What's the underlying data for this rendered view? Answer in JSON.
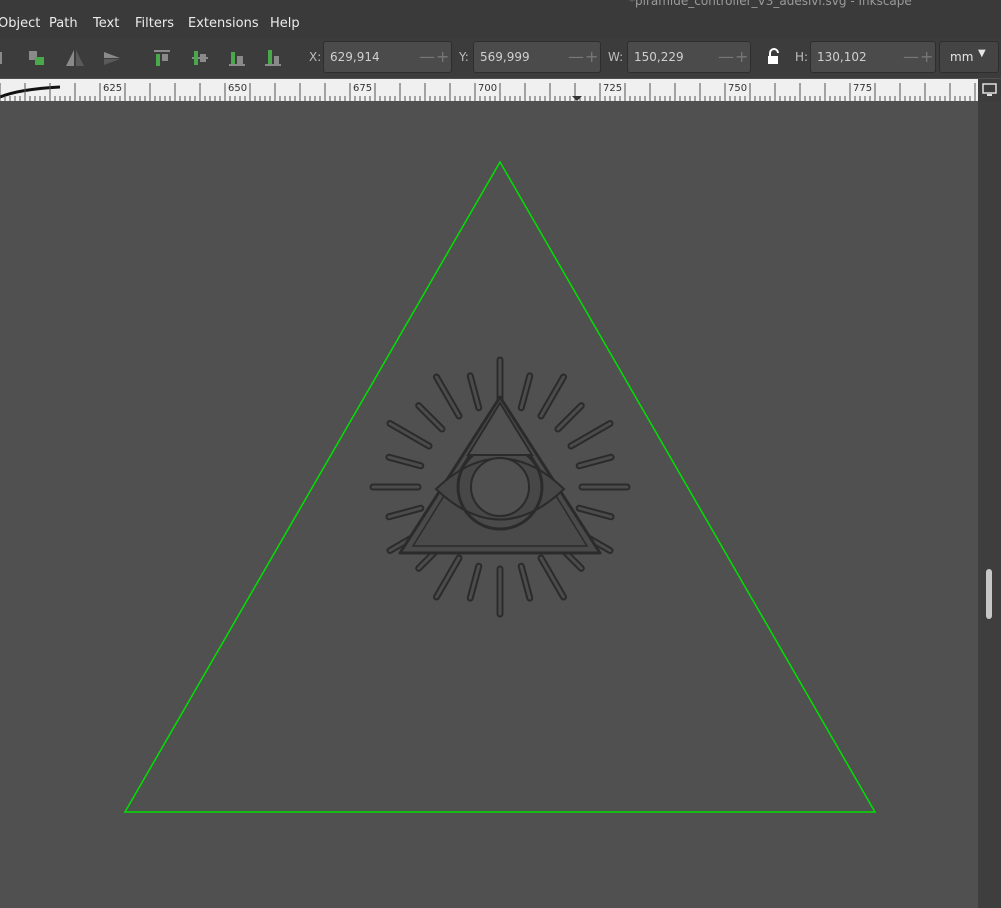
{
  "window": {
    "title": "*piramide_controller_V3_adesivi.svg - Inkscape"
  },
  "menu": {
    "items": [
      {
        "label": "Object"
      },
      {
        "label": "Path"
      },
      {
        "label": "Text"
      },
      {
        "label": "Filters"
      },
      {
        "label": "Extensions"
      },
      {
        "label": "Help"
      }
    ]
  },
  "toolbar": {
    "x": {
      "label": "X:",
      "value": "629,914"
    },
    "y": {
      "label": "Y:",
      "value": "569,999"
    },
    "w": {
      "label": "W:",
      "value": "150,229"
    },
    "h": {
      "label": "H:",
      "value": "130,102"
    },
    "unit": "mm",
    "icons": [
      "raise-icon",
      "lower-icon",
      "flip-horizontal-icon",
      "flip-vertical-icon",
      "align-top-icon",
      "align-middle-icon",
      "align-bottom-icon",
      "align-baseline-icon",
      "lock-icon",
      "chevron-down-icon"
    ]
  },
  "ruler": {
    "labels": [
      "625",
      "650",
      "675",
      "700",
      "725",
      "750",
      "775"
    ]
  },
  "colors": {
    "canvas": "#505050",
    "selection_outline": "#00e000",
    "artwork": "#2b2b2b"
  }
}
